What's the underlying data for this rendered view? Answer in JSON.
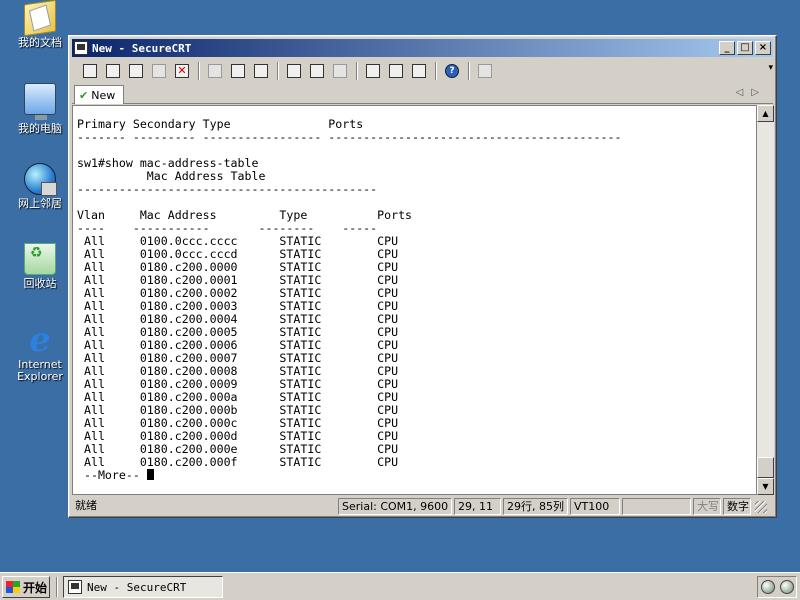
{
  "desktop": {
    "icons": [
      {
        "label": "我的文档",
        "icon": "my-documents-icon"
      },
      {
        "label": "我的电脑",
        "icon": "my-computer-icon"
      },
      {
        "label": "网上邻居",
        "icon": "network-icon"
      },
      {
        "label": "回收站",
        "icon": "recycle-bin-icon"
      },
      {
        "label_line1": "Internet",
        "label_line2": "Explorer",
        "icon": "internet-explorer-icon"
      }
    ]
  },
  "window": {
    "title": "New - SecureCRT",
    "buttons": {
      "minimize": "_",
      "maximize": "□",
      "close": "×"
    }
  },
  "tab": {
    "label": "New"
  },
  "terminal": {
    "header_cols": "Primary Secondary Type              Ports",
    "header_rule": "------- --------- ----------------- ------------------------------------------",
    "command": "sw1#show mac-address-table",
    "table_title": "          Mac Address Table",
    "title_rule": "-------------------------------------------",
    "columns": {
      "vlan": "Vlan",
      "mac": "Mac Address",
      "type": "Type",
      "ports": "Ports"
    },
    "col_rule": "----    -----------       --------    -----",
    "rows": [
      {
        "vlan": "All",
        "mac": "0100.0ccc.cccc",
        "type": "STATIC",
        "ports": "CPU"
      },
      {
        "vlan": "All",
        "mac": "0100.0ccc.cccd",
        "type": "STATIC",
        "ports": "CPU"
      },
      {
        "vlan": "All",
        "mac": "0180.c200.0000",
        "type": "STATIC",
        "ports": "CPU"
      },
      {
        "vlan": "All",
        "mac": "0180.c200.0001",
        "type": "STATIC",
        "ports": "CPU"
      },
      {
        "vlan": "All",
        "mac": "0180.c200.0002",
        "type": "STATIC",
        "ports": "CPU"
      },
      {
        "vlan": "All",
        "mac": "0180.c200.0003",
        "type": "STATIC",
        "ports": "CPU"
      },
      {
        "vlan": "All",
        "mac": "0180.c200.0004",
        "type": "STATIC",
        "ports": "CPU"
      },
      {
        "vlan": "All",
        "mac": "0180.c200.0005",
        "type": "STATIC",
        "ports": "CPU"
      },
      {
        "vlan": "All",
        "mac": "0180.c200.0006",
        "type": "STATIC",
        "ports": "CPU"
      },
      {
        "vlan": "All",
        "mac": "0180.c200.0007",
        "type": "STATIC",
        "ports": "CPU"
      },
      {
        "vlan": "All",
        "mac": "0180.c200.0008",
        "type": "STATIC",
        "ports": "CPU"
      },
      {
        "vlan": "All",
        "mac": "0180.c200.0009",
        "type": "STATIC",
        "ports": "CPU"
      },
      {
        "vlan": "All",
        "mac": "0180.c200.000a",
        "type": "STATIC",
        "ports": "CPU"
      },
      {
        "vlan": "All",
        "mac": "0180.c200.000b",
        "type": "STATIC",
        "ports": "CPU"
      },
      {
        "vlan": "All",
        "mac": "0180.c200.000c",
        "type": "STATIC",
        "ports": "CPU"
      },
      {
        "vlan": "All",
        "mac": "0180.c200.000d",
        "type": "STATIC",
        "ports": "CPU"
      },
      {
        "vlan": "All",
        "mac": "0180.c200.000e",
        "type": "STATIC",
        "ports": "CPU"
      },
      {
        "vlan": "All",
        "mac": "0180.c200.000f",
        "type": "STATIC",
        "ports": "CPU"
      }
    ],
    "more_prompt": " --More-- "
  },
  "statusbar": {
    "ready": "就绪",
    "connection": "Serial: COM1, 9600",
    "cursor_pos": "29, 11",
    "rows_cols": "29行, 85列",
    "emulation": "VT100",
    "empty": "",
    "caps": "大写",
    "num": "数字"
  },
  "taskbar": {
    "start_label": "开始",
    "task_label": "New - SecureCRT"
  }
}
